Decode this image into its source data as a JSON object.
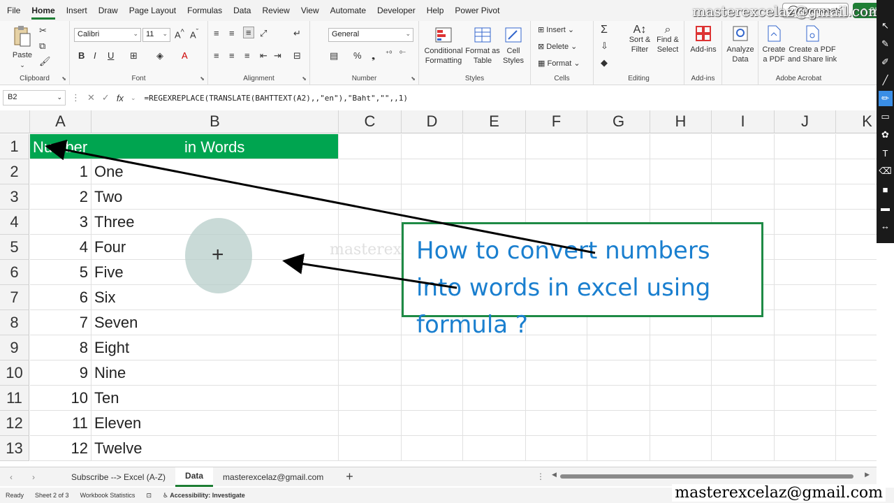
{
  "menu": [
    "File",
    "Home",
    "Insert",
    "Draw",
    "Page Layout",
    "Formulas",
    "Data",
    "Review",
    "View",
    "Automate",
    "Developer",
    "Help",
    "Power Pivot"
  ],
  "menu_active": "Home",
  "comments_label": "Comments",
  "share_label": "Shar",
  "ribbon": {
    "clipboard": {
      "paste": "Paste",
      "label": "Clipboard"
    },
    "font": {
      "name": "Calibri",
      "size": "11",
      "label": "Font"
    },
    "alignment": {
      "label": "Alignment"
    },
    "number": {
      "format": "General",
      "label": "Number"
    },
    "styles": {
      "conditional": "Conditional",
      "formatting": "Formatting",
      "format_as": "Format as",
      "table": "Table",
      "cell": "Cell",
      "cell_styles": "Styles",
      "label": "Styles"
    },
    "cells": {
      "insert": "Insert",
      "delete": "Delete",
      "format": "Format",
      "label": "Cells"
    },
    "editing": {
      "sort": "Sort &",
      "filter": "Filter",
      "find": "Find &",
      "select": "Select",
      "label": "Editing"
    },
    "addins": {
      "addins": "Add-ins",
      "label": "Add-ins"
    },
    "analyze": {
      "line1": "Analyze",
      "line2": "Data"
    },
    "acrobat": {
      "create_pdf1": "Create",
      "create_pdf2": "a PDF",
      "share1": "Create a PDF",
      "share2": "and Share link",
      "label": "Adobe Acrobat"
    }
  },
  "formula_bar": {
    "name_box": "B2",
    "formula": "=REGEXREPLACE(TRANSLATE(BAHTTEXT(A2),,\"en\"),\"Baht\",\"\",,1)"
  },
  "columns": [
    "A",
    "B",
    "C",
    "D",
    "E",
    "F",
    "G",
    "H",
    "I",
    "J",
    "K"
  ],
  "rows": [
    "1",
    "2",
    "3",
    "4",
    "5",
    "6",
    "7",
    "8",
    "9",
    "10",
    "11",
    "12",
    "13"
  ],
  "header_row": {
    "a": "Number",
    "b": "in Words"
  },
  "data_rows": [
    {
      "n": "1",
      "w": "One"
    },
    {
      "n": "2",
      "w": "Two"
    },
    {
      "n": "3",
      "w": "Three"
    },
    {
      "n": "4",
      "w": "Four"
    },
    {
      "n": "5",
      "w": "Five"
    },
    {
      "n": "6",
      "w": "Six"
    },
    {
      "n": "7",
      "w": "Seven"
    },
    {
      "n": "8",
      "w": "Eight"
    },
    {
      "n": "9",
      "w": "Nine"
    },
    {
      "n": "10",
      "w": "Ten"
    },
    {
      "n": "11",
      "w": "Eleven"
    },
    {
      "n": "12",
      "w": "Twelve"
    }
  ],
  "callout_text": "How to convert numbers into words in excel using formula ?",
  "watermark": "masterexcelaz@gmail.com",
  "watermark_faint": "masterexcelaz@gmail.com",
  "sheet_tabs": [
    "Subscribe --> Excel (A-Z)",
    "Data",
    "masterexcelaz@gmail.com"
  ],
  "sheet_active": "Data",
  "status": {
    "ready": "Ready",
    "sheet": "Sheet 2 of 3",
    "workbook": "Workbook Statistics",
    "accessibility": "Accessibility: Investigate"
  },
  "colors": {
    "accent": "#1e7e34",
    "header_fill": "#00a550",
    "callout_text": "#1a7fcf",
    "callout_border": "#1e8a45"
  }
}
